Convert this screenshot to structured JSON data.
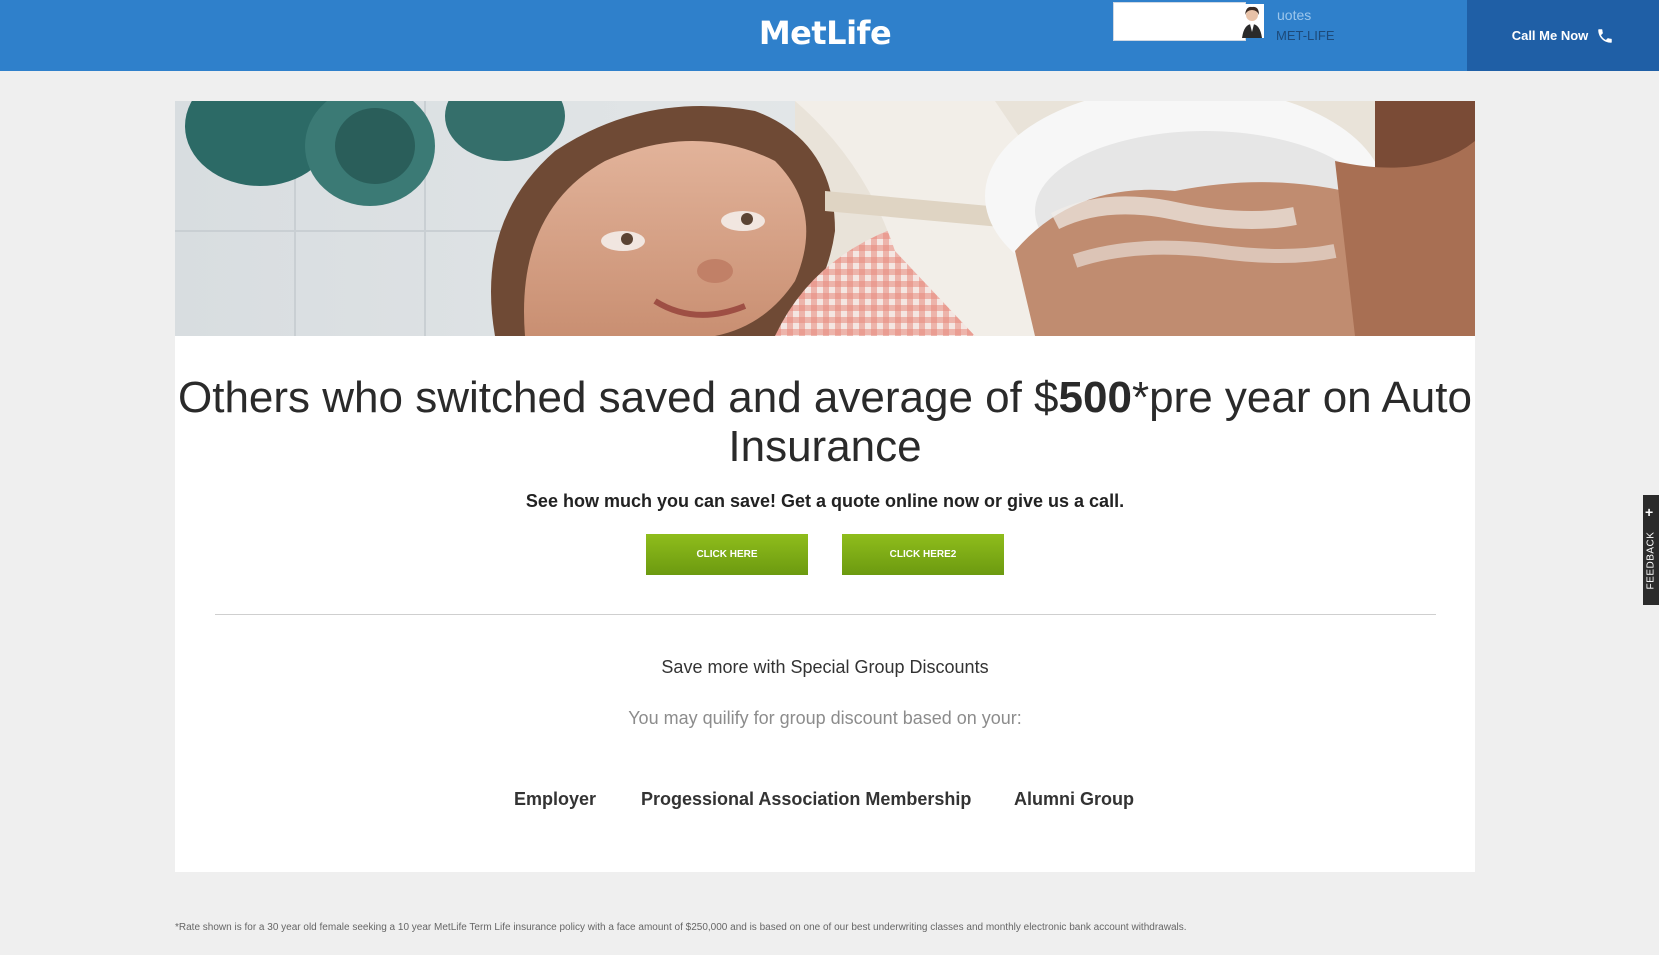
{
  "header": {
    "logo_text": "MetLife",
    "chat_line1": "uotes",
    "chat_line2": "MET-LIFE",
    "call_label": "Call Me Now"
  },
  "hero": {
    "headline_pre": "Others who switched saved and average of $",
    "headline_amount": "500",
    "headline_post": "*pre year on Auto Insurance",
    "subheading": "See how much you can save! Get a quote online now or give us a call."
  },
  "buttons": {
    "click_here": "CLICK HERE",
    "click_here2": "CLICK HERE2"
  },
  "groups": {
    "title": "Save more with Special Group Discounts",
    "qualify": "You may quilify for group discount based on your:",
    "items": [
      "Employer",
      "Progessional Association Membership",
      "Alumni Group"
    ]
  },
  "footnote": "*Rate shown is for a 30 year old female seeking a 10 year MetLife Term Life insurance policy with a face amount of $250,000 and is based on one of our best underwriting classes and monthly electronic bank account withdrawals.",
  "feedback": {
    "label": "FEEDBACK",
    "plus": "+"
  },
  "colors": {
    "header_blue": "#2f80cb",
    "call_blue": "#1f5fa6",
    "button_green": "#7eab16"
  },
  "icons": {
    "call": "phone-icon",
    "agent": "agent-avatar-icon"
  }
}
